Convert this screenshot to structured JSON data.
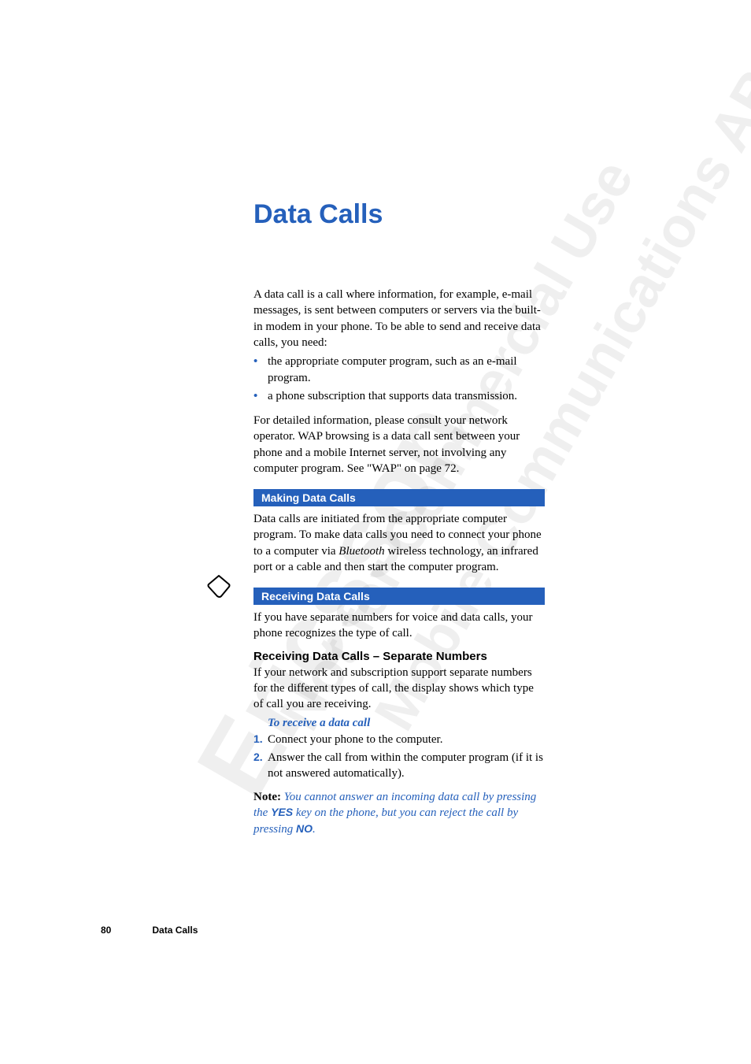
{
  "chapter_title": "Data Calls",
  "intro_para": "A data call is a call where information, for example, e-mail messages, is sent between computers or servers via the built-in modem in your phone. To be able to send and receive data calls, you need:",
  "intro_bullets": [
    "the appropriate computer program, such as an e-mail program.",
    "a phone subscription that supports data transmission."
  ],
  "intro_para2": "For detailed information, please consult your network operator. WAP browsing is a data call sent between your phone and a mobile Internet server, not involving any computer program. See \"WAP\" on page 72.",
  "section1_title": "Making Data Calls",
  "section1_para_head": "Data calls are initiated from the appropriate computer program. To make data calls you need to connect your phone to a computer via ",
  "section1_para_italic": "Bluetooth",
  "section1_para_tail": " wireless technology, an infrared port or a cable and then start the computer program.",
  "section2_title": "Receiving Data Calls",
  "section2_para": "If you have separate numbers for voice and data calls, your phone recognizes the type of call.",
  "sub2_title": "Receiving Data Calls – Separate Numbers",
  "sub2_para": "If your network and subscription support separate numbers for the different types of call, the display shows which type of call you are receiving.",
  "procedure_title": "To receive a data call",
  "steps": [
    "Connect your phone to the computer.",
    "Answer the call from within the computer program (if it is not answered automatically)."
  ],
  "note_label": "Note:",
  "note_body_1": " You cannot answer an incoming data call by pressing the ",
  "note_key_yes": "YES",
  "note_body_2": " key on the phone, but you can reject the call by pressing ",
  "note_key_no": "NO",
  "note_body_3": ".",
  "footer_page": "80",
  "footer_title": "Data Calls",
  "watermark1": "Ericsson",
  "watermark2": "Not for Commercial Use",
  "watermark3": "Mobile Communications AB"
}
